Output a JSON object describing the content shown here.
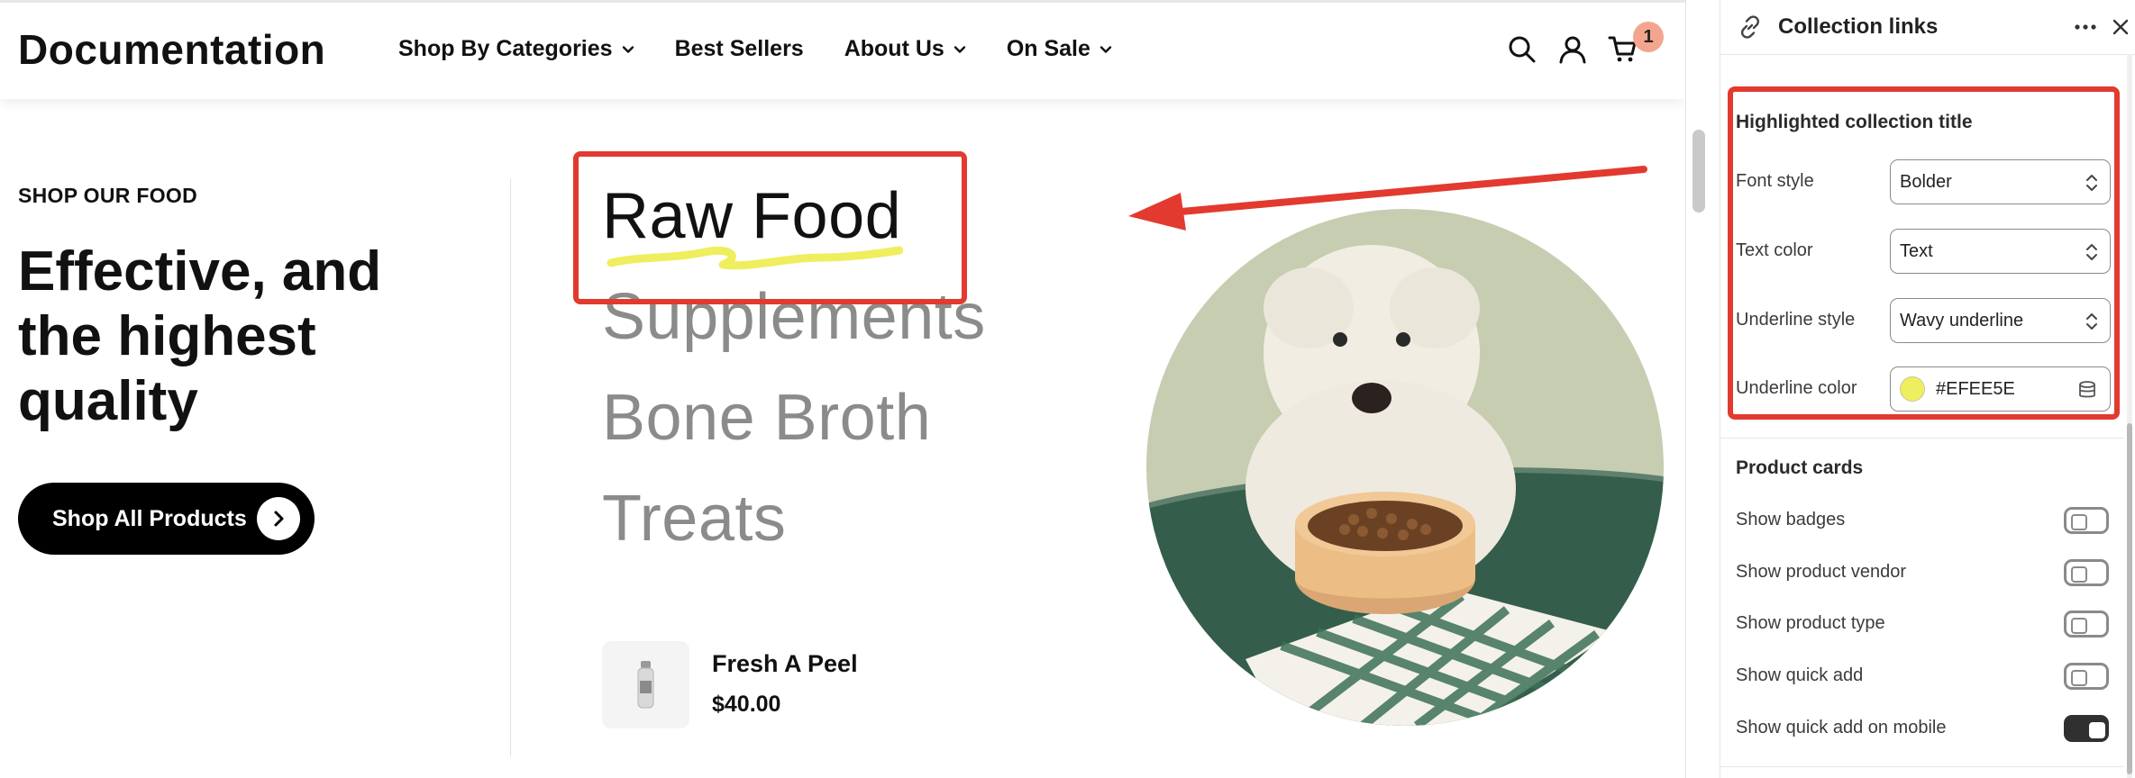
{
  "header": {
    "logo": "Documentation",
    "nav": [
      {
        "label": "Shop By Categories",
        "has_dropdown": true
      },
      {
        "label": "Best Sellers",
        "has_dropdown": false
      },
      {
        "label": "About Us",
        "has_dropdown": true
      },
      {
        "label": "On Sale",
        "has_dropdown": true
      }
    ],
    "icons": [
      "search-icon",
      "account-icon",
      "cart-icon"
    ],
    "cart_count": "1"
  },
  "hero": {
    "eyebrow": "SHOP OUR FOOD",
    "headline": "Effective, and the highest quality",
    "cta_label": "Shop All Products"
  },
  "collections": {
    "items": [
      {
        "label": "Raw Food",
        "active": true
      },
      {
        "label": "Supplements",
        "active": false
      },
      {
        "label": "Bone Broth",
        "active": false
      },
      {
        "label": "Treats",
        "active": false
      }
    ]
  },
  "product": {
    "name": "Fresh A Peel",
    "price": "$40.00"
  },
  "colors": {
    "annotation": "#e23a2f",
    "underline": "#EFEE5E",
    "cart_badge": "#f4a58f"
  },
  "panel": {
    "title": "Collection links",
    "highlighted_section": {
      "title": "Highlighted collection title",
      "font_style_label": "Font style",
      "font_style_value": "Bolder",
      "text_color_label": "Text color",
      "text_color_value": "Text",
      "underline_style_label": "Underline style",
      "underline_style_value": "Wavy underline",
      "underline_color_label": "Underline color",
      "underline_color_value": "#EFEE5E"
    },
    "product_cards": {
      "title": "Product cards",
      "toggles": [
        {
          "label": "Show badges",
          "on": false
        },
        {
          "label": "Show product vendor",
          "on": false
        },
        {
          "label": "Show product type",
          "on": false
        },
        {
          "label": "Show quick add",
          "on": false
        },
        {
          "label": "Show quick add on mobile",
          "on": true
        }
      ]
    }
  }
}
